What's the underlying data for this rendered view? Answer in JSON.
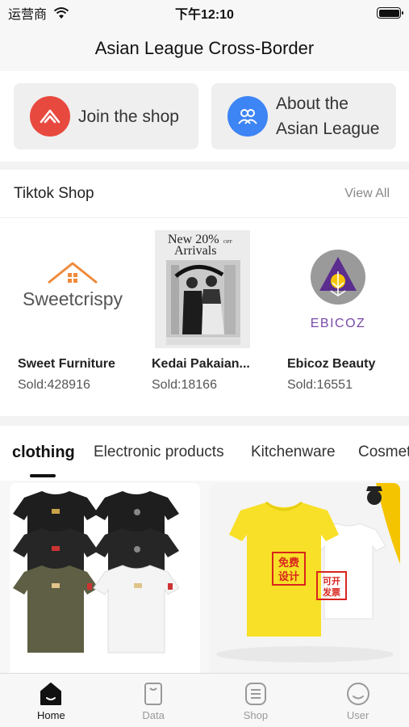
{
  "status_bar": {
    "carrier": "运营商",
    "time": "下午12:10"
  },
  "header": {
    "title": "Asian League Cross-Border"
  },
  "quick_actions": [
    {
      "label": "Join the shop",
      "icon": "join-shop-icon",
      "color": "#e8493f"
    },
    {
      "label": "About the Asian League",
      "line1": "About the",
      "line2": "Asian League",
      "icon": "people-icon",
      "color": "#3d84f5"
    }
  ],
  "tiktok_shop": {
    "title": "Tiktok Shop",
    "view_all": "View All",
    "shops": [
      {
        "name": "Sweet Furniture",
        "sold": "Sold:428916",
        "logo_text": "Sweetcrispy"
      },
      {
        "name": "Kedai Pakaian...",
        "sold": "Sold:18166",
        "poster_line1": "New 20%",
        "poster_line2": "Arrivals",
        "poster_badge": "OFF"
      },
      {
        "name": "Ebicoz Beauty",
        "sold": "Sold:16551",
        "logo_text": "EBICOZ"
      }
    ]
  },
  "categories": {
    "tabs": [
      "clothing",
      "Electronic products",
      "Kitchenware",
      "Cosmetics"
    ],
    "active": "clothing"
  },
  "products": [
    {
      "image": "tshirt-grid-image"
    },
    {
      "image": "yellow-white-tshirt-image",
      "stamp1": "免费设计",
      "stamp2": "可开发票",
      "stamp1_line1": "免费",
      "stamp1_line2": "设计",
      "stamp2_line1": "可开",
      "stamp2_line2": "发票"
    }
  ],
  "tab_bar": {
    "items": [
      {
        "label": "Home",
        "icon": "home-icon",
        "active": true
      },
      {
        "label": "Data",
        "icon": "data-icon",
        "active": false
      },
      {
        "label": "Shop",
        "icon": "shop-icon",
        "active": false
      },
      {
        "label": "User",
        "icon": "user-icon",
        "active": false
      }
    ]
  },
  "colors": {
    "accent_red": "#e8493f",
    "accent_blue": "#3d84f5",
    "orange": "#f08a3a",
    "yellow": "#f5c400",
    "purple": "#5b2d8e"
  }
}
